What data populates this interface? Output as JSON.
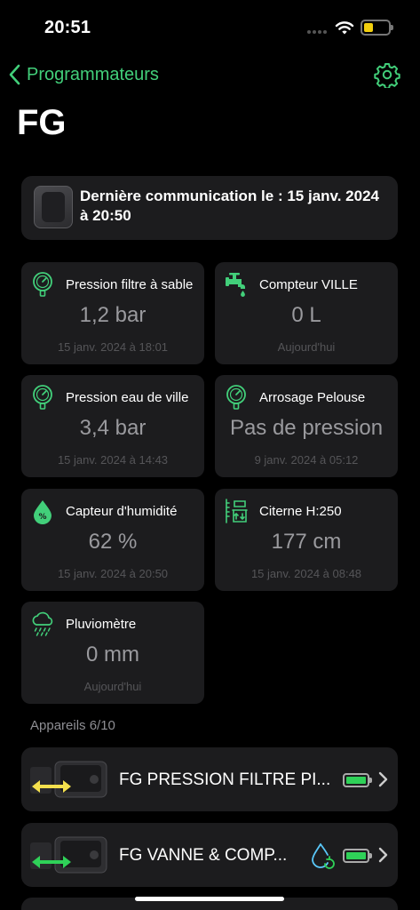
{
  "status": {
    "time": "20:51"
  },
  "nav": {
    "back_label": "Programmateurs",
    "icons": {
      "back": "chevron-left-icon",
      "settings": "gear-icon"
    }
  },
  "page": {
    "title": "FG"
  },
  "communication": {
    "text": "Dernière communication le : 15 janv. 2024 à 20:50"
  },
  "sensors": [
    {
      "name": "Pression filtre à sable",
      "value": "1,2 bar",
      "date": "15 janv. 2024 à 18:01",
      "icon": "pressure-gauge-icon"
    },
    {
      "name": "Compteur VILLE",
      "value": "0 L",
      "date": "Aujourd'hui",
      "icon": "water-tap-icon"
    },
    {
      "name": "Pression eau de ville",
      "value": "3,4 bar",
      "date": "15 janv. 2024 à 14:43",
      "icon": "pressure-gauge-icon"
    },
    {
      "name": "Arrosage Pelouse",
      "value": "Pas de pression",
      "date": "9 janv. 2024 à 05:12",
      "icon": "pressure-gauge-icon"
    },
    {
      "name": "Capteur d'humidité",
      "value": "62 %",
      "date": "15 janv. 2024 à 20:50",
      "icon": "humidity-drop-icon"
    },
    {
      "name": "Citerne H:250",
      "value": "177 cm",
      "date": "15 janv. 2024 à 08:48",
      "icon": "tank-level-icon"
    },
    {
      "name": "Pluviomètre",
      "value": "0 mm",
      "date": "Aujourd'hui",
      "icon": "rain-cloud-icon"
    }
  ],
  "devices_section": {
    "label": "Appareils 6/10"
  },
  "devices": [
    {
      "name": "FG PRESSION FILTRE PI...",
      "arrow_color": "#f4e04d",
      "battery_level": 1.0,
      "has_water_icon": false
    },
    {
      "name": "FG VANNE & COMP...",
      "arrow_color": "#2fd158",
      "battery_level": 1.0,
      "has_water_icon": true
    }
  ],
  "colors": {
    "accent": "#42cf7a",
    "battery_status": "#f2cf0e",
    "tile_bg": "#1c1c1e"
  }
}
